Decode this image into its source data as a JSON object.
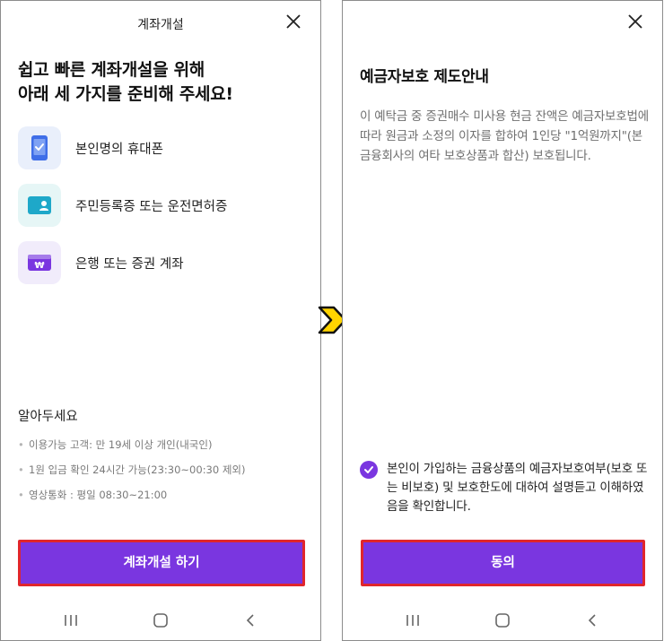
{
  "left": {
    "header_title": "계좌개설",
    "headline_line1": "쉽고 빠른 계좌개설을 위해",
    "headline_line2": "아래 세 가지를 준비해 주세요!",
    "requirements": [
      {
        "label": "본인명의 휴대폰",
        "icon": "phone-check-icon",
        "bg": "#e9effb"
      },
      {
        "label": "주민등록증 또는 운전면허증",
        "icon": "id-card-icon",
        "bg": "#e6f6f6"
      },
      {
        "label": "은행 또는 증권 계좌",
        "icon": "bank-account-icon",
        "bg": "#f1ecfb"
      }
    ],
    "notice_title": "알아두세요",
    "notices": [
      "이용가능 고객: 만 19세 이상 개인(내국인)",
      "1원 입금 확인 24시간 가능(23:30~00:30 제외)",
      "영상통화 : 평일 08:30~21:00"
    ],
    "button_label": "계좌개설 하기"
  },
  "right": {
    "title": "예금자보호 제도안내",
    "description": "이 예탁금 중 증권매수 미사용 현금 잔액은 예금자보호법에 따라 원금과 소정의 이자를 합하여 1인당 \"1억원까지\"(본 금융회사의 여타 보호상품과 합산) 보호됩니다.",
    "consent": "본인이 가입하는 금융상품의 예금자보호여부(보호 또는 비보호) 및 보호한도에 대하여 설명듣고 이해하였음을 확인합니다.",
    "button_label": "동의"
  },
  "colors": {
    "accent": "#7a36e0",
    "highlight_border": "#e0262c",
    "arrow_fill": "#ffd400"
  }
}
